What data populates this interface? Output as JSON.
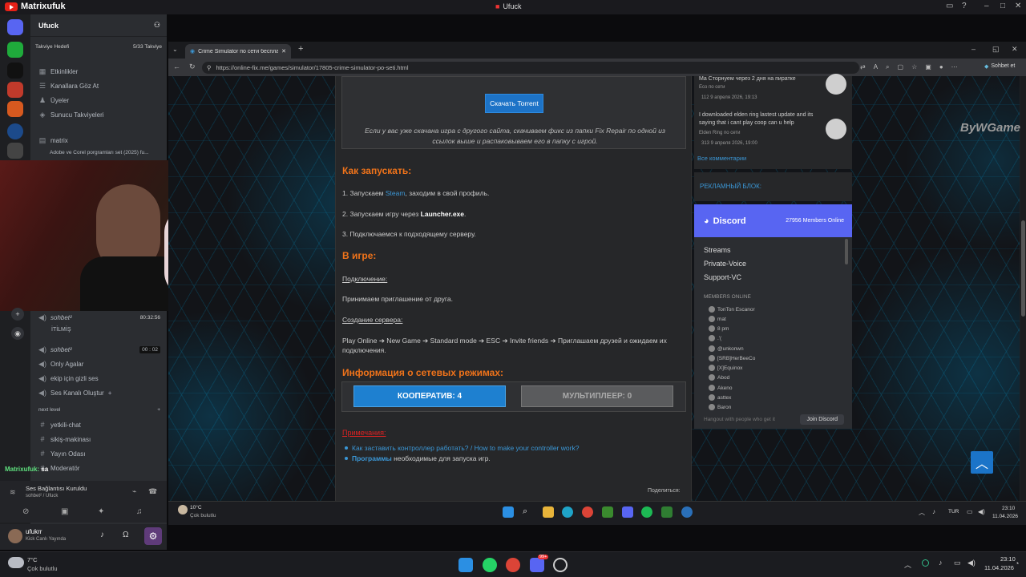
{
  "overlay": {
    "channel_name": "Matrixufuk",
    "center_title": "Ufuck"
  },
  "discord": {
    "server_name": "Ufuck",
    "boost_goal": "Takviye Hedefi",
    "boost_count": "5/33 Takviye",
    "menu": [
      {
        "label": "Etkinlikler",
        "icon": "calendar-icon"
      },
      {
        "label": "Kanallara Göz At",
        "icon": "browse-icon"
      },
      {
        "label": "Üyeler",
        "icon": "members-icon"
      },
      {
        "label": "Sunucu Takviyeleri",
        "icon": "boost-icon"
      }
    ],
    "matrix_channel": "matrix",
    "thread": "Adobe ve Corel porgramları set (2025) fu...",
    "voice_channels": [
      {
        "label": "sohbet²",
        "time": "80:32:56"
      },
      {
        "label": "İTİLMİŞ",
        "sub": true
      },
      {
        "label": "sohbet²",
        "time": "00 : 02"
      },
      {
        "label": "Only Agalar"
      },
      {
        "label": "ekip için gizli ses"
      },
      {
        "label": "Ses Kanalı Oluştur"
      }
    ],
    "category": "next level",
    "text_channels": [
      "yetkili-chat",
      "sikiş-makinası",
      "Yayın Odası",
      "Moderatör"
    ],
    "voice_status_title": "Ses Bağlantısı Kuruldu",
    "voice_status_sub": "sohbet² / Ufuck",
    "overlay_name": "Matrixufuk",
    "overlay_suffix": "sa",
    "user_name": "ufukrr",
    "user_status": "Kick Canlı Yayında"
  },
  "browser": {
    "tab_title": "Crime Simulator по сети бесплатн",
    "url": "https://online-fix.me/games/simulator/17805-crime-simulator-po-seti.html",
    "profile_label": "Sohbet et"
  },
  "page": {
    "torrent_button": "Скачать Torrent",
    "dl_note": "Если у вас уже скачана игра с другого сайта, скачиваем фикс из папки Fix Repair по одной из ссылок выше и распаковываем его в папку с игрой.",
    "how_title": "Как запускать:",
    "step1_pre": "1. Запускаем ",
    "step1_link": "Steam",
    "step1_post": ", заходим в свой профиль.",
    "step2_pre": "2. Запускаем игру через ",
    "step2_bold": "Launcher.exe",
    "step2_post": ".",
    "step3": "3. Подключаемся к подходящему серверу.",
    "ingame_title": "В игре:",
    "connect_label": "Подключение:",
    "connect_text": "Принимаем приглашение от друга.",
    "create_label": "Создание сервера:",
    "create_text": "Play Online ➔ New Game ➔ Standard mode ➔ ESC ➔ Invite friends ➔ Приглашаем друзей и ожидаем их подключения.",
    "net_title": "Информация о сетевых режимах:",
    "coop": "КООПЕРАТИВ: 4",
    "multi": "МУЛЬТИПЛЕЕР: 0",
    "notes_title": "Примечания:",
    "note1": "Как заставить контроллер работать? / How to make your controller work?",
    "note2_link": "Программы",
    "note2_text": " необходимые для запуска игр.",
    "share": "Поделиться:"
  },
  "sidebar": {
    "c0_text": "Ma Сторнуем через 2 дня на пиратке",
    "c0_game": "Eco по сети",
    "c0_meta": "112   9 апреля 2026, 19:13",
    "c1_text": "I downloaded elden ring lastest update and its saying that i cant play coop can u help",
    "c1_game": "Elden Ring по сети",
    "c1_meta": "313   9 апреля 2026, 19:00",
    "all_comments": "Все комментарии",
    "ad_title": "РЕКЛАМНЫЙ БЛОК:",
    "watermark": "ByWGame"
  },
  "discord_widget": {
    "title": "Discord",
    "online": "27956 Members Online",
    "channels": [
      "Streams",
      "Private-Voice",
      "Support-VC"
    ],
    "members_label": "MEMBERS ONLINE",
    "members": [
      "TonTon Escanor",
      "mat",
      "8 pm",
      ".'(",
      "@unkonwn",
      "[SRB]HerBeeCo",
      "[X]Equinox",
      "Abod",
      "Akeno",
      "asttex",
      "Baron"
    ],
    "footer": "Hangout with people who get it",
    "join": "Join Discord"
  },
  "inner_taskbar": {
    "temp": "10°C",
    "weather": "Çok bulutlu",
    "lang": "TUR",
    "time": "23:10",
    "date": "11.04.2026"
  },
  "taskbar": {
    "temp": "7°C",
    "weather": "Çok bulutlu",
    "time": "23:10",
    "date": "11.04.2026",
    "badge": "99+"
  },
  "colors": {
    "accent": "#1e80d0",
    "orange": "#f0731a",
    "discord": "#5865f2"
  }
}
